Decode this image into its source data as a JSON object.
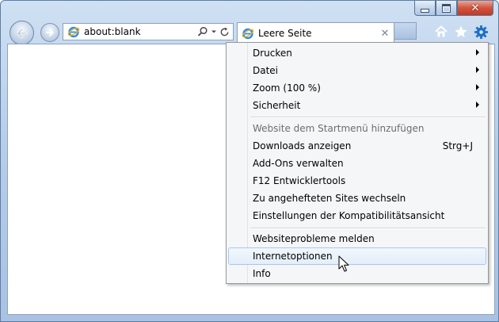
{
  "address_bar": {
    "url": "about:blank"
  },
  "tab": {
    "title": "Leere Seite",
    "close_glyph": "✕"
  },
  "caption": {
    "close_glyph": "✕"
  },
  "toolbar": {
    "icons": [
      "home-icon",
      "favorites-star-icon",
      "tools-gear-icon"
    ]
  },
  "menu": {
    "items": [
      {
        "label": "Drucken",
        "submenu": true
      },
      {
        "label": "Datei",
        "submenu": true
      },
      {
        "label": "Zoom (100 %)",
        "submenu": true
      },
      {
        "label": "Sicherheit",
        "submenu": true
      },
      {
        "label": "Website dem Startmenü hinzufügen",
        "disabled": true
      },
      {
        "label": "Downloads anzeigen",
        "shortcut": "Strg+J"
      },
      {
        "label": "Add-Ons verwalten"
      },
      {
        "label": "F12 Entwicklertools"
      },
      {
        "label": "Zu angehefteten Sites wechseln"
      },
      {
        "label": "Einstellungen der Kompatibilitätsansicht"
      },
      {
        "label": "Websiteprobleme melden"
      },
      {
        "label": "Internetoptionen",
        "highlighted": true
      },
      {
        "label": "Info"
      }
    ]
  },
  "colors": {
    "accent_blue": "#3a7bd5",
    "menu_background": "#f5f6f7",
    "hover_border": "#a8c8ef"
  }
}
